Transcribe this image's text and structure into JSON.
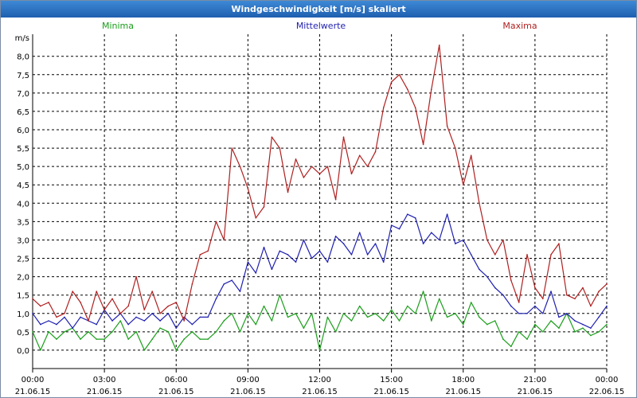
{
  "window": {
    "title": "Windgeschwindigkeit [m/s] skaliert"
  },
  "chart_data": {
    "type": "line",
    "title": "Windgeschwindigkeit [m/s] skaliert",
    "ylabel": "m/s",
    "xlabel": "",
    "ylim": [
      -0.5,
      8.6
    ],
    "xlim": [
      0,
      24
    ],
    "grid": true,
    "legend_placement": "top",
    "y_ticks": [
      "0,0",
      "0,5",
      "1,0",
      "1,5",
      "2,0",
      "2,5",
      "3,0",
      "3,5",
      "4,0",
      "4,5",
      "5,0",
      "5,5",
      "6,0",
      "6,5",
      "7,0",
      "7,5",
      "8,0"
    ],
    "y_tick_values": [
      0,
      0.5,
      1,
      1.5,
      2,
      2.5,
      3,
      3.5,
      4,
      4.5,
      5,
      5.5,
      6,
      6.5,
      7,
      7.5,
      8
    ],
    "x_ticks": [
      {
        "hours": 0,
        "time": "00:00",
        "date": "21.06.15"
      },
      {
        "hours": 3,
        "time": "03:00",
        "date": "21.06.15"
      },
      {
        "hours": 6,
        "time": "06:00",
        "date": "21.06.15"
      },
      {
        "hours": 9,
        "time": "09:00",
        "date": "21.06.15"
      },
      {
        "hours": 12,
        "time": "12:00",
        "date": "21.06.15"
      },
      {
        "hours": 15,
        "time": "15:00",
        "date": "21.06.15"
      },
      {
        "hours": 18,
        "time": "18:00",
        "date": "21.06.15"
      },
      {
        "hours": 21,
        "time": "21:00",
        "date": "21.06.15"
      },
      {
        "hours": 24,
        "time": "00:00",
        "date": "22.06.15"
      }
    ],
    "series": [
      {
        "name": "Minima",
        "color": "#1a9e1a",
        "x": [
          0,
          0.33,
          0.67,
          1,
          1.33,
          1.67,
          2,
          2.33,
          2.67,
          3,
          3.33,
          3.67,
          4,
          4.33,
          4.67,
          5,
          5.33,
          5.67,
          6,
          6.33,
          6.67,
          7,
          7.33,
          7.67,
          8,
          8.33,
          8.67,
          9,
          9.33,
          9.67,
          10,
          10.33,
          10.67,
          11,
          11.33,
          11.67,
          12,
          12.33,
          12.67,
          13,
          13.33,
          13.67,
          14,
          14.33,
          14.67,
          15,
          15.33,
          15.67,
          16,
          16.33,
          16.67,
          17,
          17.33,
          17.67,
          18,
          18.33,
          18.67,
          19,
          19.33,
          19.67,
          20,
          20.33,
          20.67,
          21,
          21.33,
          21.67,
          22,
          22.33,
          22.67,
          23,
          23.33,
          23.67,
          24
        ],
        "values": [
          0.5,
          0.0,
          0.5,
          0.3,
          0.5,
          0.6,
          0.3,
          0.5,
          0.3,
          0.3,
          0.5,
          0.8,
          0.3,
          0.5,
          0.0,
          0.3,
          0.6,
          0.5,
          0.0,
          0.3,
          0.5,
          0.3,
          0.3,
          0.5,
          0.8,
          1.0,
          0.5,
          1.0,
          0.7,
          1.2,
          0.8,
          1.5,
          0.9,
          1.0,
          0.6,
          1.0,
          0.0,
          0.9,
          0.5,
          1.0,
          0.8,
          1.2,
          0.9,
          1.0,
          0.8,
          1.1,
          0.8,
          1.2,
          1.0,
          1.6,
          0.8,
          1.4,
          0.9,
          1.0,
          0.7,
          1.3,
          0.9,
          0.7,
          0.8,
          0.3,
          0.1,
          0.5,
          0.3,
          0.7,
          0.5,
          0.8,
          0.6,
          1.0,
          0.5,
          0.6,
          0.4,
          0.5,
          0.7
        ]
      },
      {
        "name": "Mittelwerte",
        "color": "#1f1fb0",
        "x": [
          0,
          0.33,
          0.67,
          1,
          1.33,
          1.67,
          2,
          2.33,
          2.67,
          3,
          3.33,
          3.67,
          4,
          4.33,
          4.67,
          5,
          5.33,
          5.67,
          6,
          6.33,
          6.67,
          7,
          7.33,
          7.67,
          8,
          8.33,
          8.67,
          9,
          9.33,
          9.67,
          10,
          10.33,
          10.67,
          11,
          11.33,
          11.67,
          12,
          12.33,
          12.67,
          13,
          13.33,
          13.67,
          14,
          14.33,
          14.67,
          15,
          15.33,
          15.67,
          16,
          16.33,
          16.67,
          17,
          17.33,
          17.67,
          18,
          18.33,
          18.67,
          19,
          19.33,
          19.67,
          20,
          20.33,
          20.67,
          21,
          21.33,
          21.67,
          22,
          22.33,
          22.67,
          23,
          23.33,
          23.67,
          24
        ],
        "values": [
          1.0,
          0.7,
          0.8,
          0.7,
          0.9,
          0.6,
          0.9,
          0.8,
          0.7,
          1.1,
          0.8,
          1.0,
          0.7,
          0.9,
          0.8,
          1.0,
          0.8,
          1.0,
          0.6,
          0.9,
          0.7,
          0.9,
          0.9,
          1.4,
          1.8,
          1.9,
          1.6,
          2.4,
          2.1,
          2.8,
          2.2,
          2.7,
          2.6,
          2.4,
          3.0,
          2.5,
          2.7,
          2.4,
          3.1,
          2.9,
          2.6,
          3.2,
          2.6,
          2.9,
          2.4,
          3.4,
          3.3,
          3.7,
          3.6,
          2.9,
          3.2,
          3.0,
          3.7,
          2.9,
          3.0,
          2.6,
          2.2,
          2.0,
          1.7,
          1.5,
          1.2,
          1.0,
          1.0,
          1.2,
          1.0,
          1.6,
          0.9,
          1.0,
          0.8,
          0.7,
          0.6,
          0.9,
          1.2
        ]
      },
      {
        "name": "Maxima",
        "color": "#b01f1f",
        "x": [
          0,
          0.33,
          0.67,
          1,
          1.33,
          1.67,
          2,
          2.33,
          2.67,
          3,
          3.33,
          3.67,
          4,
          4.33,
          4.67,
          5,
          5.33,
          5.67,
          6,
          6.33,
          6.67,
          7,
          7.33,
          7.67,
          8,
          8.33,
          8.67,
          9,
          9.33,
          9.67,
          10,
          10.33,
          10.67,
          11,
          11.33,
          11.67,
          12,
          12.33,
          12.67,
          13,
          13.33,
          13.67,
          14,
          14.33,
          14.67,
          15,
          15.33,
          15.67,
          16,
          16.33,
          16.67,
          17,
          17.33,
          17.67,
          18,
          18.33,
          18.67,
          19,
          19.33,
          19.67,
          20,
          20.33,
          20.67,
          21,
          21.33,
          21.67,
          22,
          22.33,
          22.67,
          23,
          23.33,
          23.67,
          24
        ],
        "values": [
          1.4,
          1.2,
          1.3,
          0.9,
          1.0,
          1.6,
          1.3,
          0.8,
          1.6,
          1.1,
          1.4,
          1.0,
          1.2,
          2.0,
          1.1,
          1.6,
          1.0,
          1.2,
          1.3,
          0.8,
          1.8,
          2.6,
          2.7,
          3.5,
          3.0,
          5.5,
          5.0,
          4.4,
          3.6,
          3.9,
          5.8,
          5.5,
          4.3,
          5.2,
          4.7,
          5.0,
          4.8,
          5.0,
          4.1,
          5.8,
          4.8,
          5.3,
          5.0,
          5.4,
          6.6,
          7.3,
          7.5,
          7.1,
          6.6,
          5.6,
          7.1,
          8.3,
          6.1,
          5.5,
          4.5,
          5.3,
          4.0,
          3.0,
          2.6,
          3.0,
          1.9,
          1.3,
          2.6,
          1.7,
          1.4,
          2.6,
          2.9,
          1.5,
          1.4,
          1.7,
          1.2,
          1.6,
          1.8
        ]
      }
    ]
  }
}
